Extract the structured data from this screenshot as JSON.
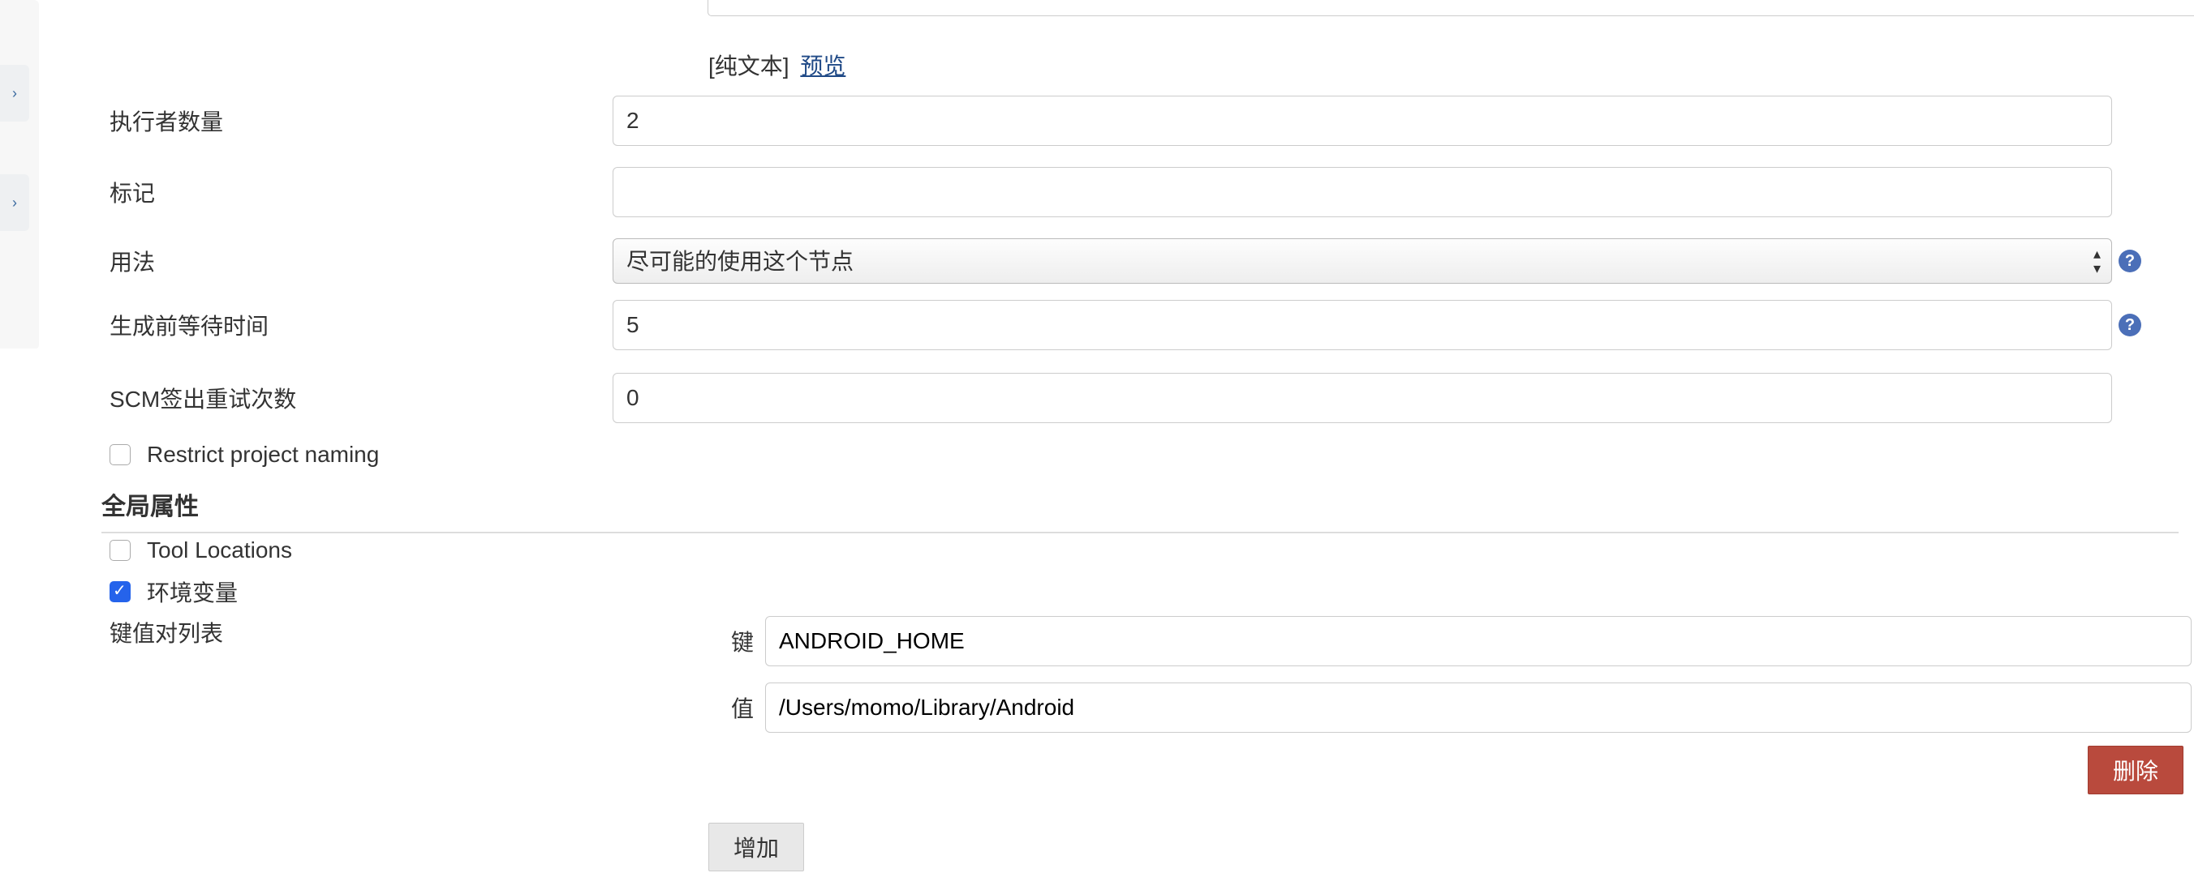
{
  "preview": {
    "plain_label": "[纯文本]",
    "preview_link": "预览"
  },
  "fields": {
    "executors_label": "执行者数量",
    "executors_value": "2",
    "tag_label": "标记",
    "tag_value": "",
    "usage_label": "用法",
    "usage_selected": "尽可能的使用这个节点",
    "wait_label": "生成前等待时间",
    "wait_value": "5",
    "scm_label": "SCM签出重试次数",
    "scm_value": "0"
  },
  "checkboxes": {
    "restrict_label": "Restrict project naming",
    "restrict_checked": false,
    "tool_locations_label": "Tool Locations",
    "tool_locations_checked": false,
    "env_vars_label": "环境变量",
    "env_vars_checked": true
  },
  "section": {
    "global_props": "全局属性"
  },
  "kv": {
    "list_label": "键值对列表",
    "key_label": "键",
    "key_value": "ANDROID_HOME",
    "value_label": "值",
    "value_value": "/Users/momo/Library/Android"
  },
  "buttons": {
    "delete": "删除",
    "add": "增加"
  },
  "help_glyph": "?"
}
